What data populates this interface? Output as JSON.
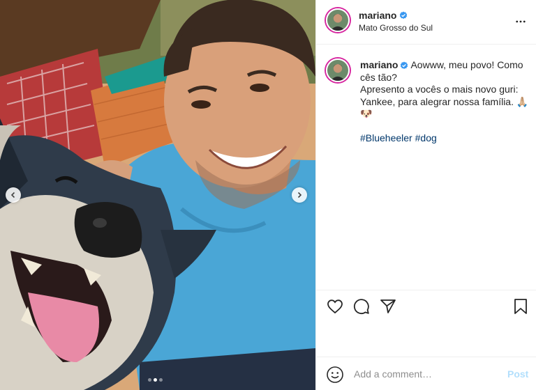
{
  "post": {
    "author": {
      "username": "mariano",
      "verified": true,
      "location": "Mato Grosso do Sul"
    },
    "caption": {
      "username": "mariano",
      "line1": "Aowww, meu povo! Como cês tão?",
      "line2": "Apresento a vocês o mais novo guri: Yankee, para alegrar nossa família. 🙏🏼🐶",
      "hashtags": [
        "#Blueheeler",
        "#dog"
      ]
    },
    "carousel": {
      "slide_count": 3,
      "active_slide": 2
    }
  },
  "icons": {
    "more": "more-horizontal-icon",
    "verified": "verified-badge-icon",
    "like": "heart-icon",
    "comment": "comment-bubble-icon",
    "share": "paper-plane-icon",
    "save": "bookmark-icon",
    "emoji": "smiley-icon",
    "prev": "chevron-left-icon",
    "next": "chevron-right-icon"
  },
  "comment_box": {
    "placeholder": "Add a comment…",
    "post_label": "Post"
  },
  "colors": {
    "verified": "#3897f0",
    "hashtag": "#00376b",
    "post_disabled": "#b2dffc",
    "story_ring": "#d6249f"
  }
}
